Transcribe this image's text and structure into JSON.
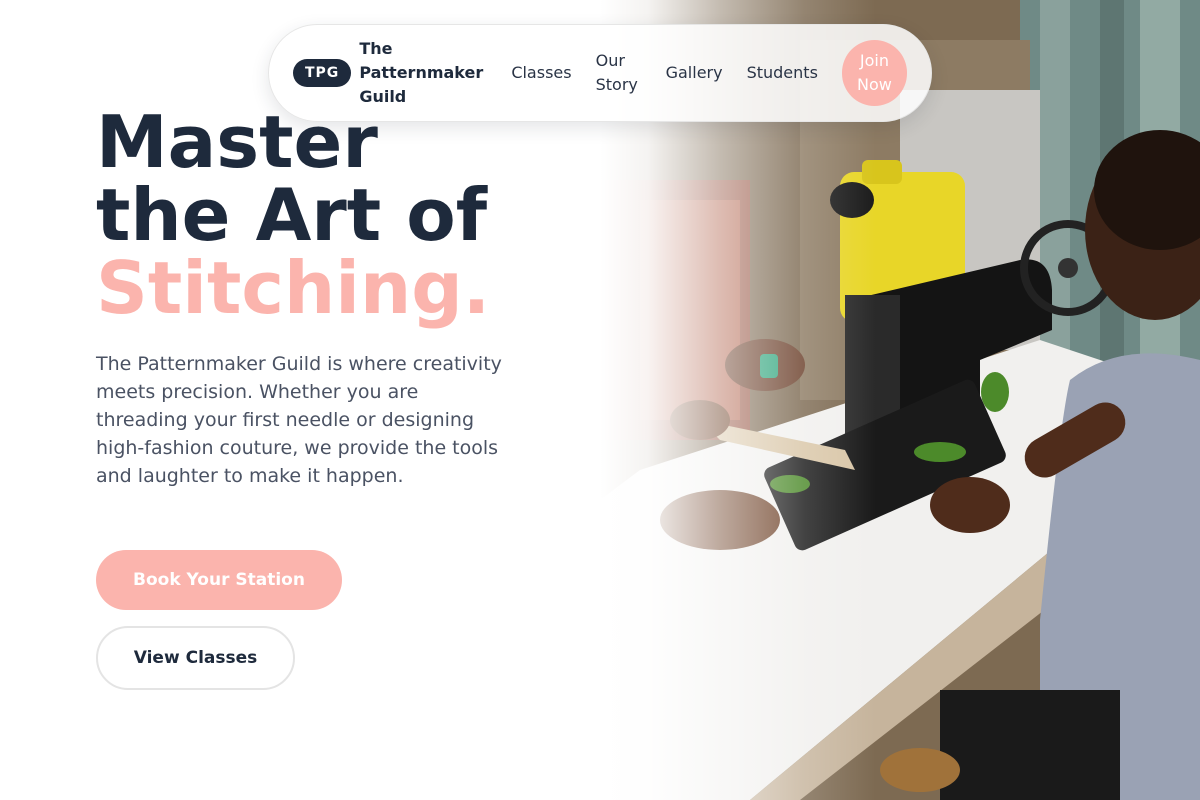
{
  "nav": {
    "logo_badge": "TPG",
    "brand_name": "The Patternmaker Guild",
    "links": [
      "Classes",
      "Our Story",
      "Gallery",
      "Students"
    ],
    "cta": "Join Now"
  },
  "hero": {
    "title_line1": "Master",
    "title_line2": "the Art of",
    "title_accent": "Stitching.",
    "description": "The Patternmaker Guild is where creativity meets precision. Whether you are threading your first needle or designing high-fashion couture, we provide the tools and laughter to make it happen.",
    "primary_button": "Book Your Station",
    "secondary_button": "View Classes",
    "image_alt": "Child working at a vintage treadle sewing machine"
  },
  "colors": {
    "navy": "#1e2a3c",
    "accent_pink": "#fbb4ad",
    "body_text": "#4a5263"
  }
}
